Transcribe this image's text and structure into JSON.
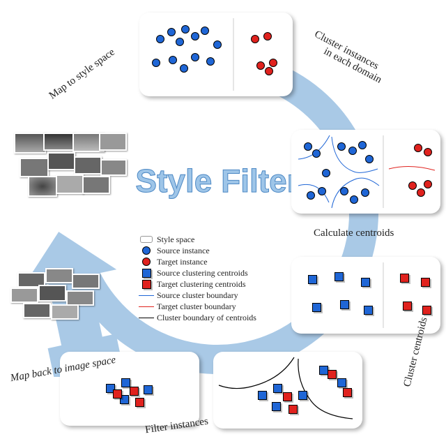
{
  "title": "Style Filter",
  "labels": {
    "map_to_style": "Map to style space",
    "cluster_each_1": "Cluster instances",
    "cluster_each_2": "in each domain",
    "calc_centroids": "Calculate centroids",
    "cluster_centroids": "Cluster centroids",
    "filter_instances": "Filter instances",
    "map_back": "Map back to image space"
  },
  "legend": {
    "style_space": "Style space",
    "source_instance": "Source instance",
    "target_instance": "Target instance",
    "source_centroid": "Source clustering centroids",
    "target_centroid": "Target clustering centroids",
    "source_boundary": "Source cluster boundary",
    "target_boundary": "Target cluster boundary",
    "centroid_boundary": "Cluster boundary of centroids"
  },
  "panels": {
    "p1": {
      "desc": "style-space-scatter",
      "blue_dots": 12,
      "red_dots": 5
    },
    "p2": {
      "desc": "clustered-scatter-boundaries",
      "blue_clusters": 4,
      "red_clusters": 2
    },
    "p3": {
      "desc": "centroid-grid",
      "blue_sq": 6,
      "red_sq": 4
    },
    "p4": {
      "desc": "centroid-clustered",
      "blue_sq": 6,
      "red_sq": 4
    },
    "p5": {
      "desc": "filtered-instances",
      "blue_sq": 4,
      "red_sq": 3
    }
  }
}
